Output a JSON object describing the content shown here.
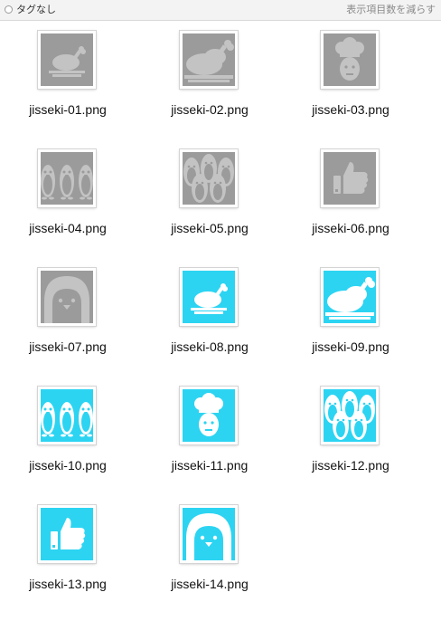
{
  "header": {
    "tag_label": "タグなし",
    "show_less_label": "表示項目数を減らす"
  },
  "colors": {
    "gray_bg": "#9b9b9b",
    "gray_fg": "#c3c3c3",
    "cyan_bg": "#2cd4f2",
    "cyan_fg": "#ffffff"
  },
  "files": [
    {
      "name": "jisseki-01.png",
      "icon": "roast-chicken-icon",
      "style": "gray"
    },
    {
      "name": "jisseki-02.png",
      "icon": "roast-chicken-large-icon",
      "style": "gray"
    },
    {
      "name": "jisseki-03.png",
      "icon": "chef-icon",
      "style": "gray"
    },
    {
      "name": "jisseki-04.png",
      "icon": "penguins-icon",
      "style": "gray"
    },
    {
      "name": "jisseki-05.png",
      "icon": "penguin-group-icon",
      "style": "gray"
    },
    {
      "name": "jisseki-06.png",
      "icon": "thumbs-up-icon",
      "style": "gray"
    },
    {
      "name": "jisseki-07.png",
      "icon": "penguin-face-icon",
      "style": "gray"
    },
    {
      "name": "jisseki-08.png",
      "icon": "roast-chicken-icon",
      "style": "cyan"
    },
    {
      "name": "jisseki-09.png",
      "icon": "roast-chicken-large-icon",
      "style": "cyan"
    },
    {
      "name": "jisseki-10.png",
      "icon": "penguins-icon",
      "style": "cyan"
    },
    {
      "name": "jisseki-11.png",
      "icon": "chef-icon",
      "style": "cyan"
    },
    {
      "name": "jisseki-12.png",
      "icon": "penguin-group-icon",
      "style": "cyan"
    },
    {
      "name": "jisseki-13.png",
      "icon": "thumbs-up-icon",
      "style": "cyan"
    },
    {
      "name": "jisseki-14.png",
      "icon": "penguin-face-icon",
      "style": "cyan"
    }
  ]
}
